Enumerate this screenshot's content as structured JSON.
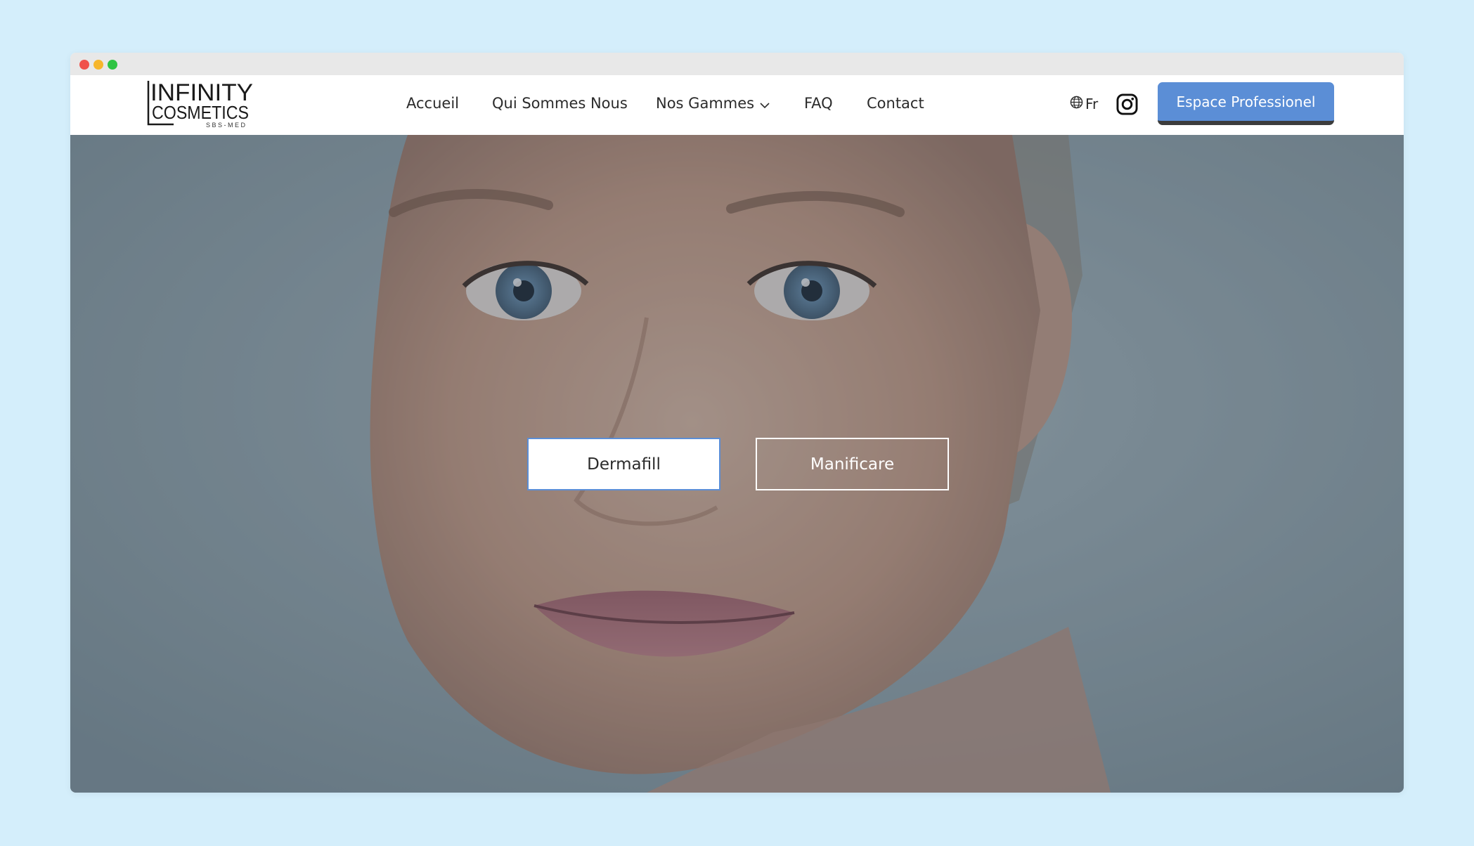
{
  "window": {
    "controls": [
      "close",
      "minimize",
      "maximize"
    ]
  },
  "brand": {
    "line1": "INFINITY",
    "line2": "COSMETICS",
    "line3": "SBS-MED"
  },
  "nav": {
    "items": [
      {
        "label": "Accueil"
      },
      {
        "label": "Qui Sommes Nous"
      },
      {
        "label": "Nos Gammes",
        "icon": "chevron-down-icon"
      },
      {
        "label": "FAQ"
      },
      {
        "label": "Contact"
      }
    ],
    "language": "Fr",
    "language_icon": "globe-icon",
    "social_icon": "instagram-icon",
    "pro_button": "Espace Professionel"
  },
  "hero": {
    "buttons": [
      {
        "label": "Dermafill"
      },
      {
        "label": "Manificare"
      }
    ]
  },
  "colors": {
    "accent": "#5b8ed6",
    "page_background": "#d4eefb",
    "text": "#2b2b2b"
  }
}
